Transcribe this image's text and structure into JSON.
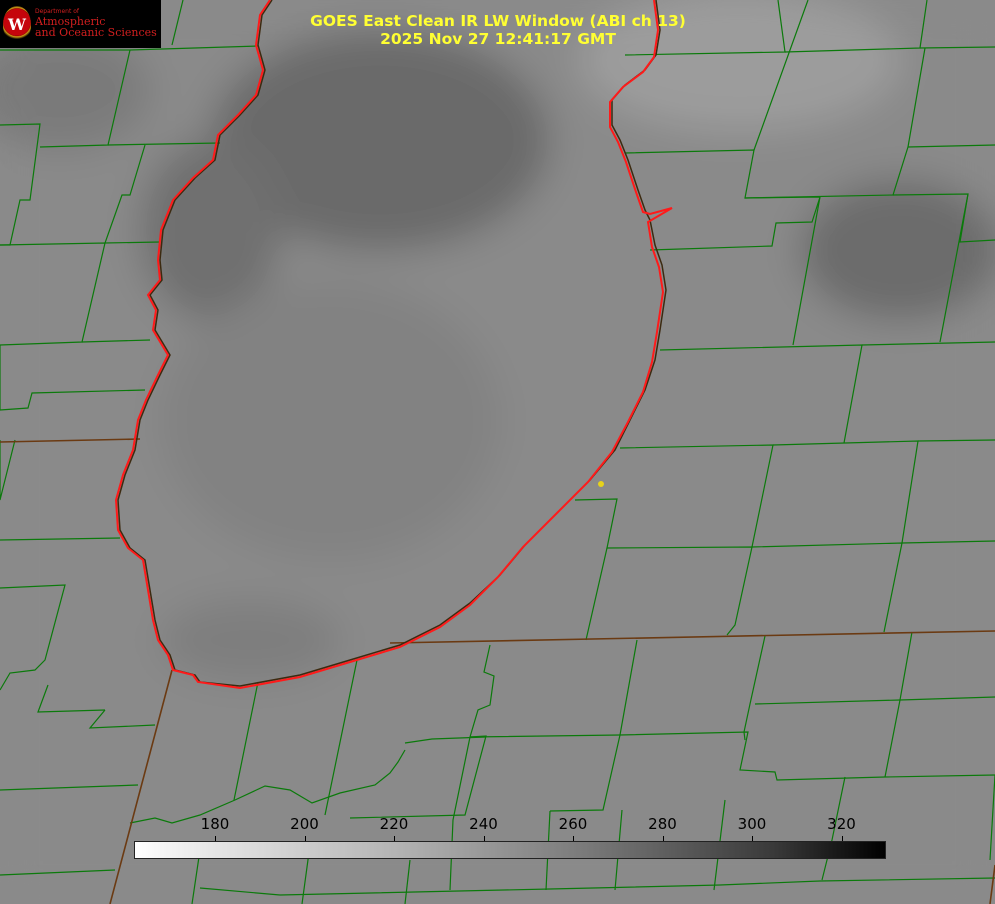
{
  "header": {
    "title_line1": "GOES East Clean IR LW Window (ABI ch 13)",
    "title_line2": "2025 Nov 27 12:41:17 GMT",
    "text_color": "#ffff33"
  },
  "logo": {
    "dept": "Department of",
    "line1": "Atmospheric",
    "line2": "and Oceanic Sciences",
    "shield_letter": "W",
    "icon": "uw-crest-icon"
  },
  "colorbar": {
    "ticks": [
      "180",
      "200",
      "220",
      "240",
      "260",
      "280",
      "300",
      "320"
    ],
    "min_color": "#ffffff",
    "max_color": "#000000"
  },
  "map": {
    "colors": {
      "county_lines": "#0b7a0b",
      "state_lines": "#6b3a12",
      "shoreline": "#ff1a1a",
      "site_marker": "#e6d21a"
    },
    "icons": [
      "site-marker-icon"
    ]
  }
}
